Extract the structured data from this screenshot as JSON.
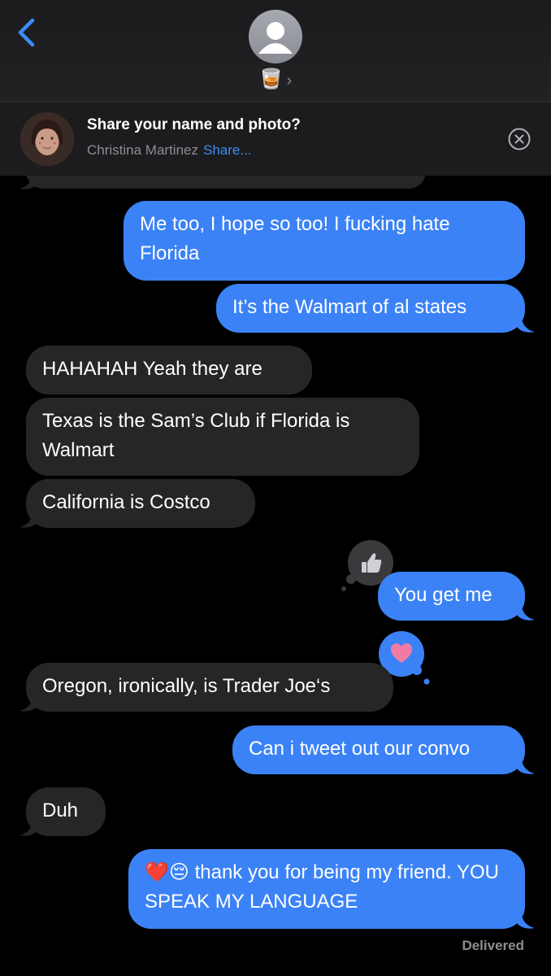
{
  "header": {
    "contact_emoji": "🥃",
    "chevron": "›"
  },
  "share_banner": {
    "title": "Share your name and photo?",
    "name": "Christina Martinez",
    "share_label": "Share..."
  },
  "messages": [
    {
      "from": "me",
      "text": "Me too, I hope so too! I fucking hate Florida"
    },
    {
      "from": "me",
      "text": "It’s the Walmart of al states"
    },
    {
      "from": "them",
      "text": "HAHAHAH Yeah they are"
    },
    {
      "from": "them",
      "text": "Texas is the Sam’s Club if Florida is Walmart"
    },
    {
      "from": "them",
      "text": "California is Costco"
    },
    {
      "from": "me",
      "text": "You get me",
      "reaction": "thumbs-up"
    },
    {
      "from": "them",
      "text": "Oregon, ironically, is Trader Joe‘s",
      "reaction": "heart"
    },
    {
      "from": "me",
      "text": "Can i tweet out our convo"
    },
    {
      "from": "them",
      "text": "Duh"
    },
    {
      "from": "me",
      "emoji": "❤️😔",
      "text": "thank you for being my friend. YOU SPEAK MY LANGUAGE"
    }
  ],
  "status": "Delivered",
  "colors": {
    "sent_bubble": "#3b82f6",
    "received_bubble": "#262628",
    "accent": "#3b8cf6"
  }
}
